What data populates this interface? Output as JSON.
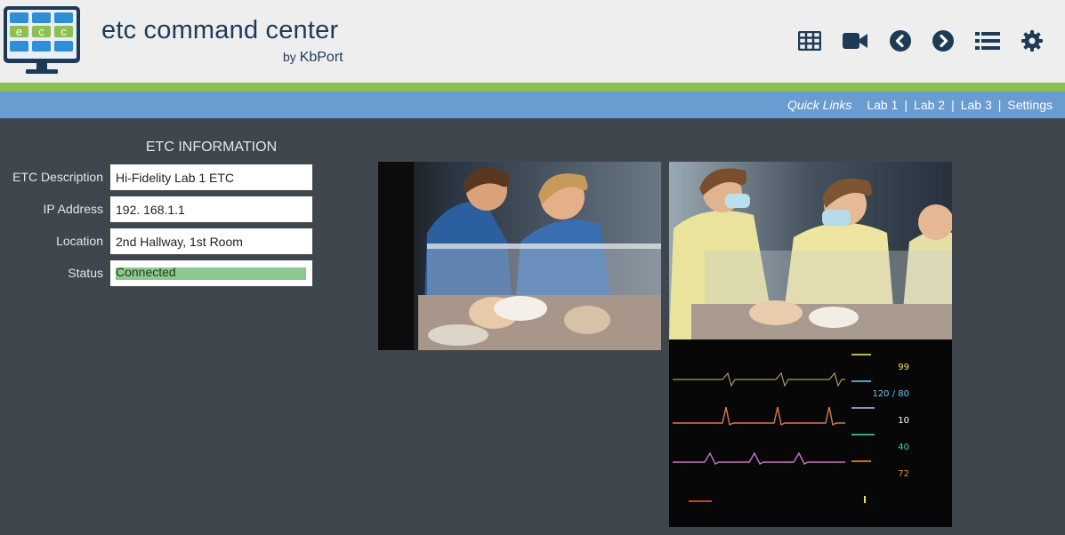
{
  "header": {
    "logo_text": [
      "e",
      "c",
      "c"
    ],
    "title": "etc command center",
    "by_prefix": "by",
    "company": "KbPort"
  },
  "toolbar": [
    {
      "name": "grid-view-button",
      "icon": "grid-icon"
    },
    {
      "name": "camera-view-button",
      "icon": "video-camera-icon"
    },
    {
      "name": "previous-button",
      "icon": "chevron-left-circle-icon"
    },
    {
      "name": "next-button",
      "icon": "chevron-right-circle-icon"
    },
    {
      "name": "list-view-button",
      "icon": "list-icon"
    },
    {
      "name": "settings-button",
      "icon": "gear-icon"
    }
  ],
  "quick_links": {
    "label": "Quick Links",
    "links": [
      "Lab 1",
      "Lab 2",
      "Lab 3",
      "Settings"
    ],
    "separator": "|"
  },
  "etc_info": {
    "heading": "ETC INFORMATION",
    "fields": [
      {
        "label": "ETC Description",
        "value": "Hi-Fidelity Lab 1 ETC"
      },
      {
        "label": "IP Address",
        "value": "192. 168.1.1"
      },
      {
        "label": "Location",
        "value": "2nd Hallway, 1st Room"
      },
      {
        "label": "Status",
        "value": "Connected"
      }
    ]
  },
  "vitals": [
    {
      "value": "99",
      "color": "#f1e34a"
    },
    {
      "value": "120 / 80",
      "color": "#5ec9f0"
    },
    {
      "value": "10",
      "color": "#ffffff"
    },
    {
      "value": "40",
      "color": "#35d3b6"
    },
    {
      "value": "72",
      "color": "#f08a2a"
    }
  ],
  "colors": {
    "header_bg": "#eeeeee",
    "green_strip": "#8cc152",
    "blue_bar": "#6a9bd1",
    "page_bg": "#3f464e",
    "brand_navy": "#1d3b57",
    "status_green": "#8ec88e"
  }
}
